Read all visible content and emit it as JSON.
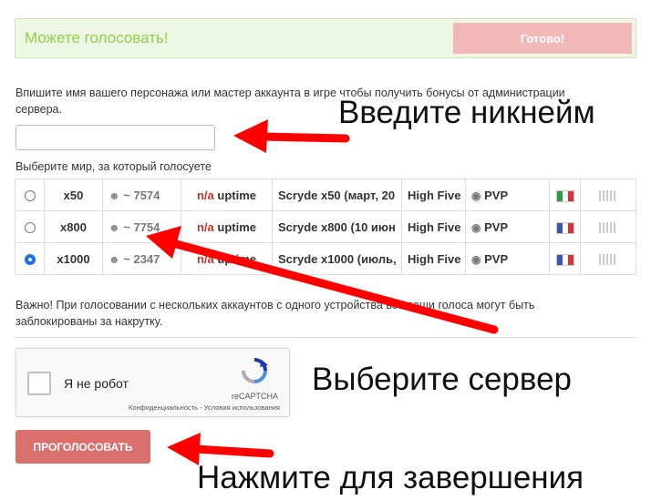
{
  "status": {
    "message": "Можете голосовать!",
    "done_label": "Готово!"
  },
  "form": {
    "instruction": "Впишите имя вашего персонажа или мастер аккаунта в игре чтобы получить бонусы от администрации сервера.",
    "name_value": "",
    "world_label": "Выберите мир, за который голосуете"
  },
  "servers": [
    {
      "selected": false,
      "rate": "x50",
      "online": "~ 7574",
      "uptime_prefix": "n/a",
      "uptime_suffix": " uptime",
      "name": "Scryde x50 (март, 20",
      "chronicle": "High Five",
      "type": "PVP",
      "flag": "IT"
    },
    {
      "selected": false,
      "rate": "x800",
      "online": "~ 7754",
      "uptime_prefix": "n/a",
      "uptime_suffix": " uptime",
      "name": "Scryde x800 (10 июн",
      "chronicle": "High Five",
      "type": "PVP",
      "flag": "FR"
    },
    {
      "selected": true,
      "rate": "x1000",
      "online": "~ 2347",
      "uptime_prefix": "n/a",
      "uptime_suffix": " uptime",
      "name": "Scryde x1000 (июль,",
      "chronicle": "High Five",
      "type": "PVP",
      "flag": "FR"
    }
  ],
  "warning": "Важно! При голосовании с нескольких аккаунтов с одного устройства все ваши голоса могут быть заблокированы за накрутку.",
  "recaptcha": {
    "label": "Я не робот",
    "brand": "reCAPTCHA",
    "privacy": "Конфиденциальность",
    "separator": " - ",
    "terms": "Условия использования"
  },
  "vote_button": "ПРОГОЛОСОВАТЬ",
  "annotations": {
    "enter_nickname": "Введите никнейм",
    "choose_server": "Выберите сервер",
    "click_to_finish": "Нажмите для завершения"
  },
  "colors": {
    "accent_green": "#8fd14a",
    "done_button": "#f2b7b7",
    "vote_button": "#d9706e",
    "arrow_red": "#ff0000",
    "radio_selected": "#1a73e8"
  }
}
